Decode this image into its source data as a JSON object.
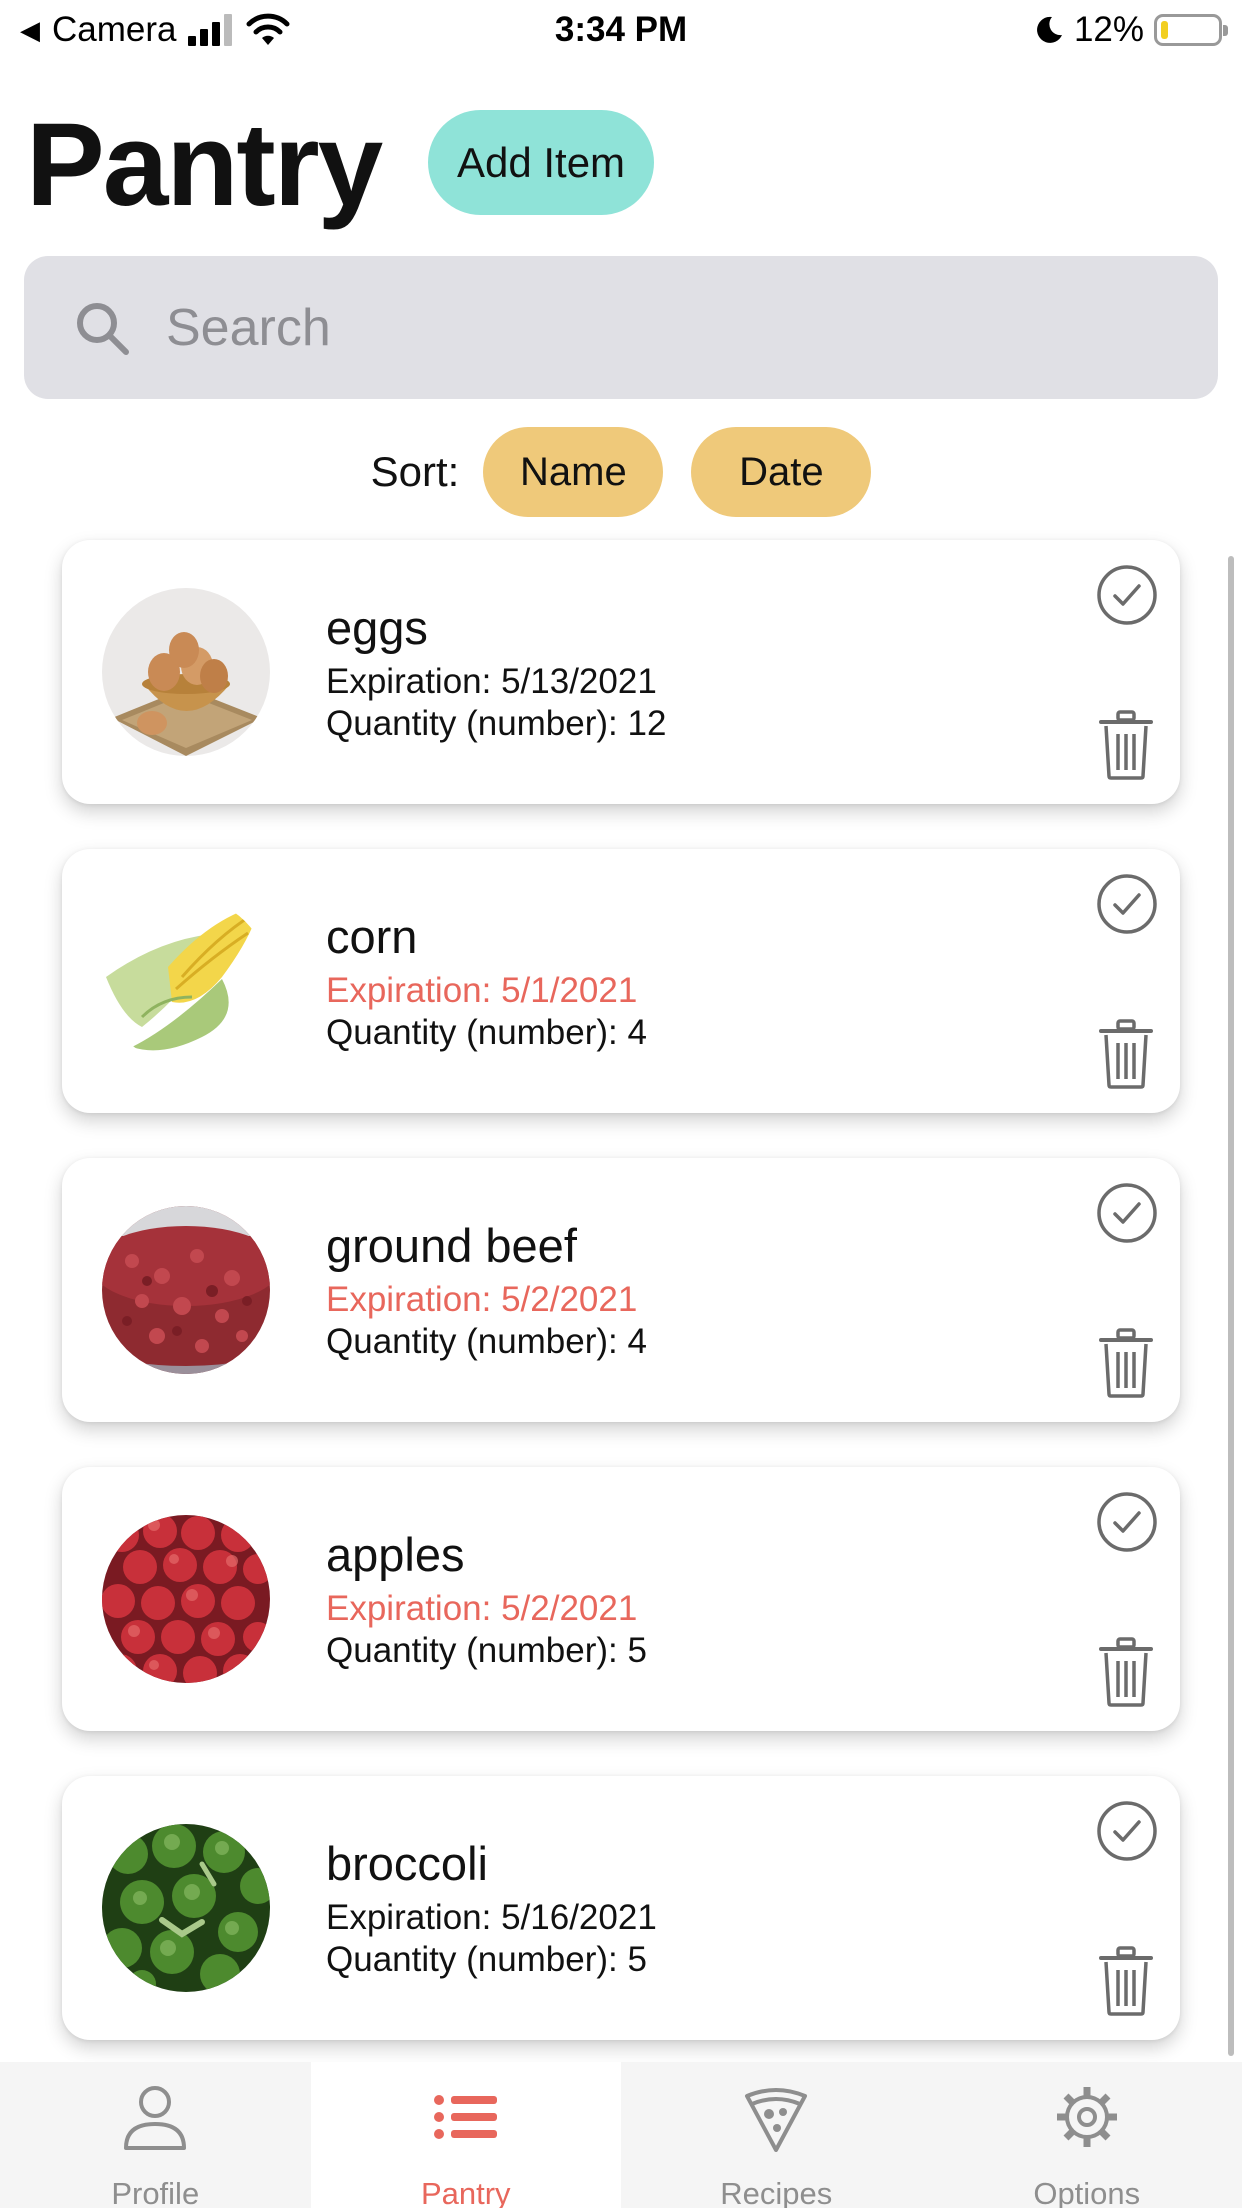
{
  "status_bar": {
    "back_app": "Camera",
    "time": "3:34 PM",
    "battery": "12%",
    "battery_level": 0.12
  },
  "header": {
    "title": "Pantry",
    "add_item_label": "Add Item"
  },
  "search": {
    "placeholder": "Search",
    "value": ""
  },
  "sort": {
    "label": "Sort:",
    "options": [
      "Name",
      "Date"
    ]
  },
  "items": [
    {
      "name": "eggs",
      "expiration": "Expiration: 5/13/2021",
      "quantity": "Quantity (number): 12",
      "expired": false,
      "image": "eggs-photo"
    },
    {
      "name": "corn",
      "expiration": "Expiration: 5/1/2021",
      "quantity": "Quantity (number): 4",
      "expired": true,
      "image": "corn-photo"
    },
    {
      "name": "ground beef",
      "expiration": "Expiration: 5/2/2021",
      "quantity": "Quantity (number): 4",
      "expired": true,
      "image": "ground-beef-photo"
    },
    {
      "name": "apples",
      "expiration": "Expiration: 5/2/2021",
      "quantity": "Quantity (number): 5",
      "expired": true,
      "image": "apples-photo"
    },
    {
      "name": "broccoli",
      "expiration": "Expiration: 5/16/2021",
      "quantity": "Quantity (number): 5",
      "expired": false,
      "image": "broccoli-photo"
    }
  ],
  "tabs": [
    {
      "label": "Profile",
      "icon": "person-icon",
      "active": false
    },
    {
      "label": "Pantry",
      "icon": "list-icon",
      "active": true
    },
    {
      "label": "Recipes",
      "icon": "pizza-icon",
      "active": false
    },
    {
      "label": "Options",
      "icon": "gear-icon",
      "active": false
    }
  ],
  "colors": {
    "accent": "#e8675c",
    "add_button": "#8fe3d8",
    "sort_button": "#efc97a",
    "search_bg": "#e0e0e5",
    "tab_inactive": "#8e8e8e"
  }
}
